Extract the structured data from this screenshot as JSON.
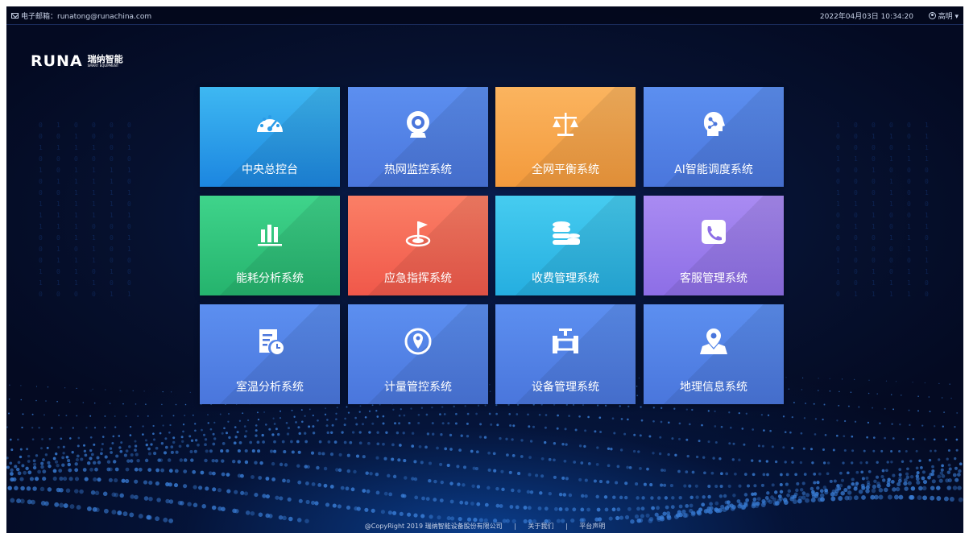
{
  "topbar": {
    "email": "电子邮箱：runatong@runachina.com",
    "datetime": "2022年04月03日 10:34:20",
    "user": "高明 ▾"
  },
  "logo": {
    "word": "RUNA",
    "cn": "瑞纳智能",
    "sub": "SMART EQUIPMENT"
  },
  "tiles": [
    {
      "label": "中央总控台",
      "icon": "dashboard-icon",
      "color_top": "#3eb8f2",
      "color_bottom": "#1c86e0"
    },
    {
      "label": "热网监控系统",
      "icon": "webcam-icon",
      "color_top": "#5c8ff0",
      "color_bottom": "#4a76dc"
    },
    {
      "label": "全网平衡系统",
      "icon": "scale-icon",
      "color_top": "#fbb45f",
      "color_bottom": "#f39a3c"
    },
    {
      "label": "AI智能调度系统",
      "icon": "ai-brain-icon",
      "color_top": "#5c8ff0",
      "color_bottom": "#4a76dc"
    },
    {
      "label": "能耗分析系统",
      "icon": "bar-chart-icon",
      "color_top": "#3fd48b",
      "color_bottom": "#25b36d"
    },
    {
      "label": "应急指挥系统",
      "icon": "flag-target-icon",
      "color_top": "#fb7f66",
      "color_bottom": "#f0584a"
    },
    {
      "label": "收费管理系统",
      "icon": "coins-icon",
      "color_top": "#46ccf0",
      "color_bottom": "#25aee0"
    },
    {
      "label": "客服管理系统",
      "icon": "phone-icon",
      "color_top": "#a98bf2",
      "color_bottom": "#8d6ee6"
    },
    {
      "label": "室温分析系统",
      "icon": "report-clock-icon",
      "color_top": "#5c8ff0",
      "color_bottom": "#4a76dc"
    },
    {
      "label": "计量管控系统",
      "icon": "location-circle-icon",
      "color_top": "#5c8ff0",
      "color_bottom": "#4a76dc"
    },
    {
      "label": "设备管理系统",
      "icon": "valve-icon",
      "color_top": "#5c8ff0",
      "color_bottom": "#4a76dc"
    },
    {
      "label": "地理信息系统",
      "icon": "map-pin-icon",
      "color_top": "#5c8ff0",
      "color_bottom": "#4a76dc"
    }
  ],
  "footer": {
    "copyright": "@CopyRight 2019 瑞纳智能设备股份有限公司",
    "sep1": "|",
    "about": "关于我们",
    "sep2": "|",
    "statement": "平台声明"
  }
}
